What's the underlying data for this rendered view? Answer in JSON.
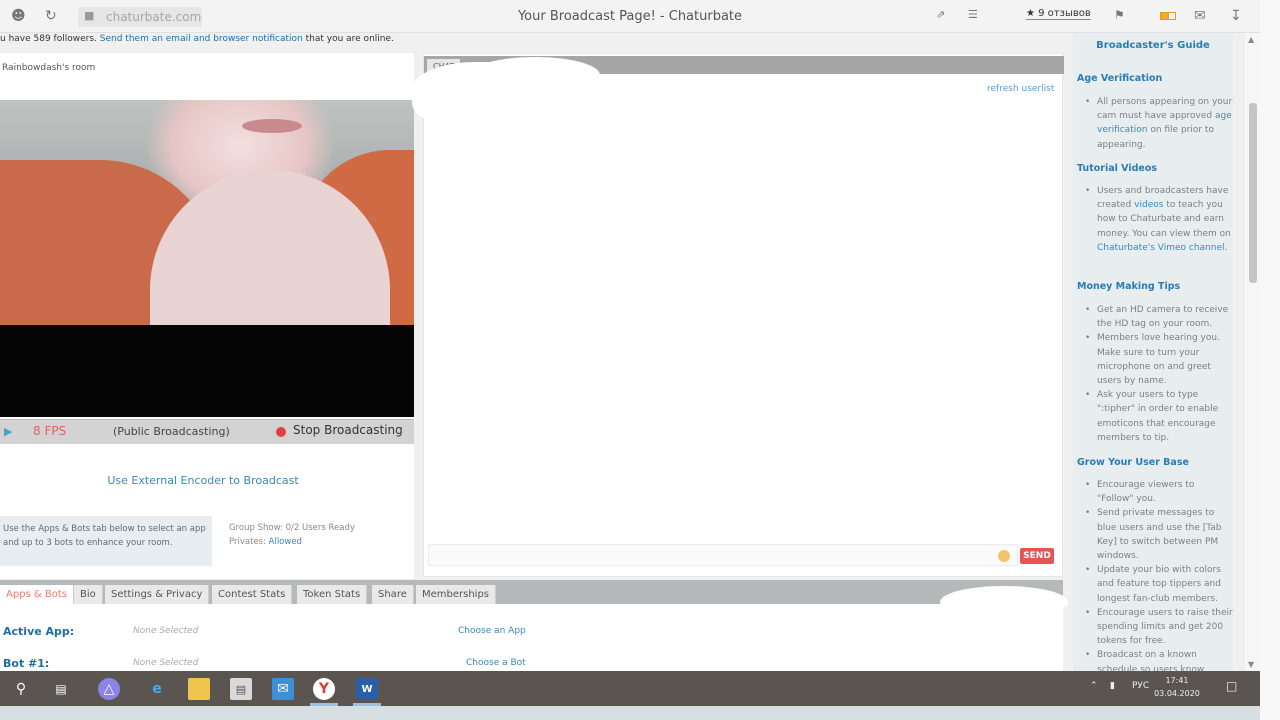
{
  "browser": {
    "url": "chaturbate.com",
    "title": "Your Broadcast Page! - Chaturbate",
    "reviews": "★ 9 отзывов"
  },
  "notice": {
    "prefix": "u have 589 followers.",
    "link": "Send them an email and browser notification",
    "suffix": "that you are online."
  },
  "room": {
    "title": "Rainbowdash's room",
    "fps": "8 FPS",
    "status": "(Public Broadcasting)",
    "stop_label": "Stop Broadcasting",
    "external_encoder": "Use External Encoder to Broadcast",
    "apps_note": "Use the Apps & Bots tab below to select an app and up to 3 bots to enhance your room.",
    "group_show": "Group Show: 0/2 Users Ready",
    "privates_label": "Privates:",
    "privates_value": "Allowed"
  },
  "chat": {
    "tab_label": "CHAT",
    "refresh": "refresh userlist",
    "send": "SEND"
  },
  "bottom_tabs": [
    "Apps & Bots",
    "Bio",
    "Settings & Privacy",
    "Contest Stats",
    "Token Stats",
    "Share",
    "Memberships"
  ],
  "apps": {
    "active_app_label": "Active App:",
    "active_app_value": "None Selected",
    "choose_app": "Choose an App",
    "bot1_label": "Bot #1:",
    "bot1_value": "None Selected",
    "choose_bot": "Choose a Bot"
  },
  "sidebar": {
    "guide_title": "Broadcaster's Guide",
    "age": {
      "heading": "Age Verification",
      "text1": "All persons appearing on your cam must have approved",
      "link": "age verification",
      "text2": "on file prior to appearing."
    },
    "tutorial": {
      "heading": "Tutorial Videos",
      "text1": "Users and broadcasters have created",
      "link1": "videos",
      "text2": "to teach you how to Chaturbate and earn money. You can view them on",
      "link2": "Chaturbate's Vimeo channel",
      "text3": "."
    },
    "money": {
      "heading": "Money Making Tips",
      "items": [
        "Get an HD camera to receive the HD tag on your room.",
        "Members love hearing you. Make sure to turn your microphone on and greet users by name.",
        "Ask your users to type \":tipher\" in order to enable emoticons that encourage members to tip."
      ]
    },
    "grow": {
      "heading": "Grow Your User Base",
      "items": [
        "Encourage viewers to \"Follow\" you.",
        "Send private messages to blue users and use the [Tab Key] to switch between PM windows.",
        "Update your bio with colors and feature top tippers and longest fan-club members.",
        "Encourage users to raise their spending limits and get 200 tokens for free.",
        "Broadcast on a known schedule so users know"
      ]
    }
  },
  "taskbar": {
    "lang": "РУС",
    "time": "17:41",
    "date": "03.04.2020"
  }
}
